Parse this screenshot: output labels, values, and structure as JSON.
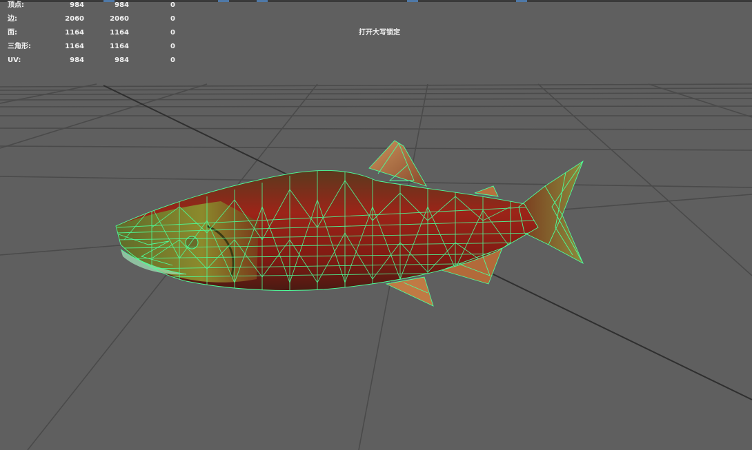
{
  "hud": {
    "rows": [
      {
        "label": "顶点:",
        "v1": "984",
        "v2": "984",
        "v3": "0"
      },
      {
        "label": "边:",
        "v1": "2060",
        "v2": "2060",
        "v3": "0"
      },
      {
        "label": "面:",
        "v1": "1164",
        "v2": "1164",
        "v3": "0"
      },
      {
        "label": "三角形:",
        "v1": "1164",
        "v2": "1164",
        "v3": "0"
      },
      {
        "label": "UV:",
        "v1": "984",
        "v2": "984",
        "v3": "0"
      }
    ]
  },
  "status": {
    "caps_lock": "打开大写锁定"
  },
  "colors": {
    "background": "#5f5f5f",
    "grid": "#4a4a4a",
    "grid_axis": "#2f2f2f",
    "wireframe": "#4cff9a",
    "fish_body": "#8a1c14",
    "fish_head": "#6e7a2a"
  },
  "icons": {
    "viewport": "3d-viewport",
    "model": "salmon-mesh-wireframe"
  }
}
